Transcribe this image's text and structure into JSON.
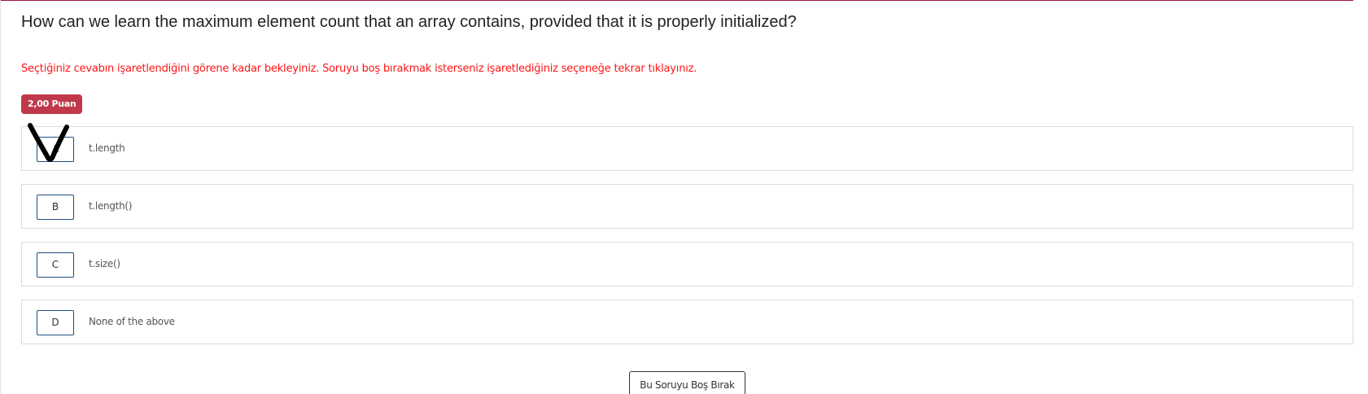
{
  "question": {
    "text": "How can we learn the maximum element count that an array contains, provided that it is properly initialized?"
  },
  "instruction": {
    "text": "Seçtiğiniz cevabın işaretlendiğini görene kadar bekleyiniz. Soruyu boş bırakmak isterseniz işaretlediğiniz seçeneğe tekrar tıklayınız."
  },
  "points_badge": {
    "label": "2,00 Puan"
  },
  "options": [
    {
      "letter": "A",
      "text": "t.length",
      "selected": true
    },
    {
      "letter": "B",
      "text": "t.length()",
      "selected": false
    },
    {
      "letter": "C",
      "text": "t.size()",
      "selected": false
    },
    {
      "letter": "D",
      "text": "None of the above",
      "selected": false
    }
  ],
  "leave_blank_button": {
    "label": "Bu Soruyu Boş Bırak"
  },
  "colors": {
    "accent": "#a4173b",
    "warning_text": "#ff1414",
    "badge_bg": "#c0394b",
    "option_letter_border": "#1f4f82"
  },
  "icons": {
    "selected_mark": "handdrawn-check-icon"
  }
}
